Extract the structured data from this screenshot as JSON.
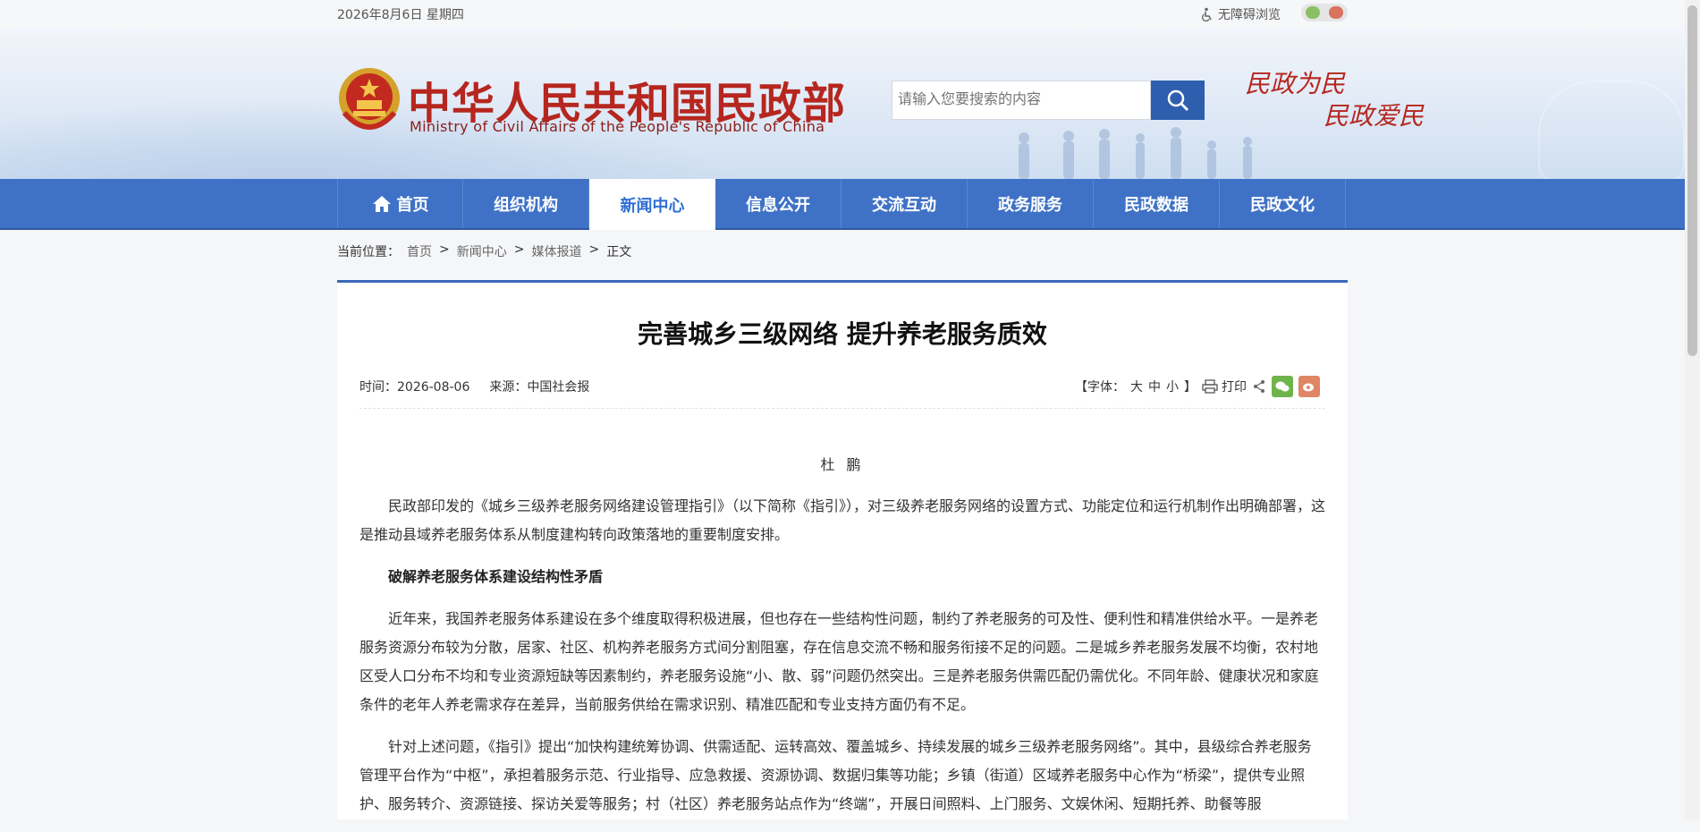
{
  "topbar": {
    "date": "2026年8月6日 星期四",
    "accessibility": "无障碍浏览"
  },
  "header": {
    "title_cn": "中华人民共和国民政部",
    "title_en": "Ministry of Civil Affairs of the People's Republic of China",
    "search_placeholder": "请输入您要搜索的内容",
    "slogan_line1": "民政为民",
    "slogan_line2": "民政爱民"
  },
  "nav": {
    "items": [
      "首页",
      "组织机构",
      "新闻中心",
      "信息公开",
      "交流互动",
      "政务服务",
      "民政数据",
      "民政文化"
    ],
    "active": "新闻中心"
  },
  "breadcrumb": {
    "label": "当前位置：",
    "items": [
      "首页",
      "新闻中心",
      "媒体报道"
    ],
    "separator": ">",
    "current": "正文"
  },
  "article": {
    "title": "完善城乡三级网络 提升养老服务质效",
    "time": "时间：2026-08-06",
    "source": "来源：中国社会报",
    "font_size_label_open": "【字体：",
    "font_large": "大",
    "font_medium": "中",
    "font_small": "小",
    "font_size_label_close": "】",
    "print_label": "打印",
    "author": "杜 鹏",
    "paragraphs": [
      "民政部印发的《城乡三级养老服务网络建设管理指引》（以下简称《指引》），对三级养老服务网络的设置方式、功能定位和运行机制作出明确部署，这是推动县域养老服务体系从制度建构转向政策落地的重要制度安排。",
      "破解养老服务体系建设结构性矛盾",
      "近年来，我国养老服务体系建设在多个维度取得积极进展，但也存在一些结构性问题，制约了养老服务的可及性、便利性和精准供给水平。一是养老服务资源分布较为分散，居家、社区、机构养老服务方式间分割阻塞，存在信息交流不畅和服务衔接不足的问题。二是城乡养老服务发展不均衡，农村地区受人口分布不均和专业资源短缺等因素制约，养老服务设施“小、散、弱”问题仍然突出。三是养老服务供需匹配仍需优化。不同年龄、健康状况和家庭条件的老年人养老需求存在差异，当前服务供给在需求识别、精准匹配和专业支持方面仍有不足。",
      "针对上述问题，《指引》提出“加快构建统筹协调、供需适配、运转高效、覆盖城乡、持续发展的城乡三级养老服务网络”。其中，县级综合养老服务管理平台作为“中枢”，承担着服务示范、行业指导、应急救援、资源协调、数据归集等功能；乡镇（街道）区域养老服务中心作为“桥梁”，提供专业照护、服务转介、资源链接、探访关爱等服务；村（社区）养老服务站点作为“终端”，开展日间照料、上门服务、文娱休闲、短期托养、助餐等服"
    ]
  },
  "colors": {
    "nav_blue": "#3f72c6",
    "brand_red": "#b6261e",
    "active_text": "#2e6fd3"
  }
}
